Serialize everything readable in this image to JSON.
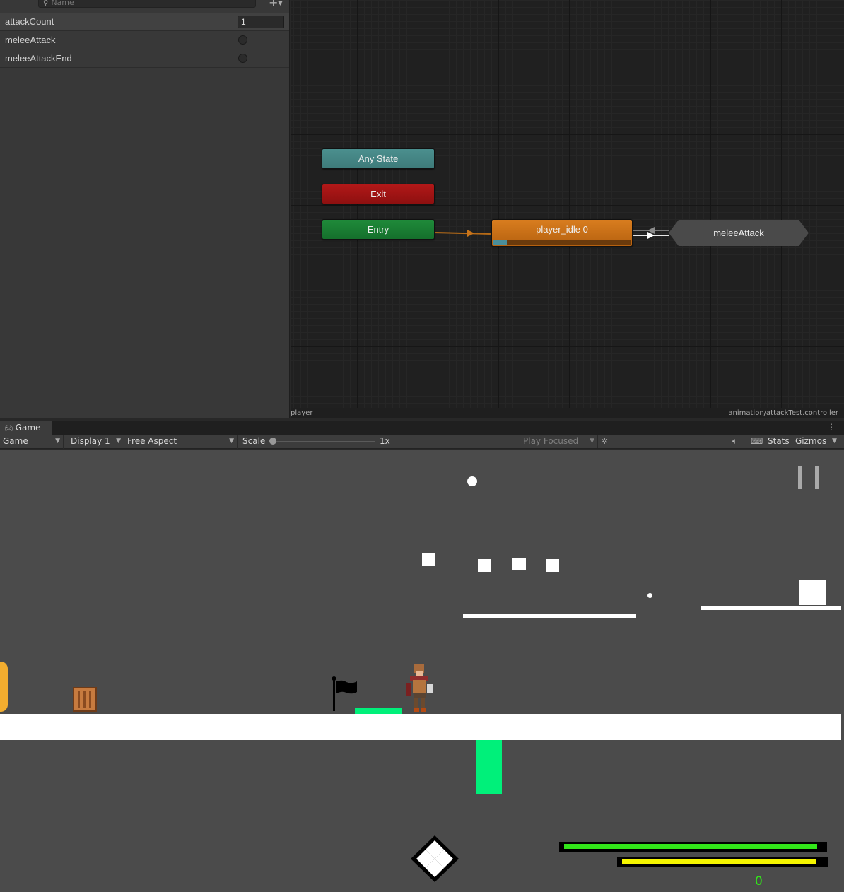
{
  "parameters": {
    "search_placeholder": "Name",
    "add_label": "+",
    "items": [
      {
        "name": "attackCount",
        "type": "int",
        "value": "1"
      },
      {
        "name": "meleeAttack",
        "type": "trigger"
      },
      {
        "name": "meleeAttackEnd",
        "type": "trigger"
      }
    ]
  },
  "graph": {
    "nodes": {
      "any_state": "Any State",
      "exit": "Exit",
      "entry": "Entry",
      "idle": "player_idle 0",
      "melee": "meleeAttack"
    },
    "idle_progress": 0.1,
    "colors": {
      "any_state": "#4b8f8e",
      "exit": "#b21818",
      "entry": "#1f8a3a",
      "default_state": "#d87d1f",
      "state": "#4a4a4a"
    }
  },
  "status": {
    "left": "player",
    "right": "animation/attackTest.controller"
  },
  "game_tab": {
    "title": "Game",
    "icon": "gamepad-icon",
    "menu": "⋮"
  },
  "toolbar": {
    "view_mode": "Game",
    "display": "Display 1",
    "aspect": "Free Aspect",
    "scale_label": "Scale",
    "scale_value": "1x",
    "play_focused": "Play Focused",
    "stats": "Stats",
    "gizmos": "Gizmos",
    "icons": [
      "bug-icon",
      "mute-icon",
      "keyboard-icon"
    ]
  },
  "game": {
    "score": "0",
    "health_fraction": 0.98,
    "stamina_fraction": 0.97,
    "colors": {
      "background": "#4b4b4b",
      "platform": "#ffffff",
      "pickup": "#00f07a",
      "health": "#32e619",
      "stamina": "#f5f500",
      "score": "#32e619"
    }
  }
}
